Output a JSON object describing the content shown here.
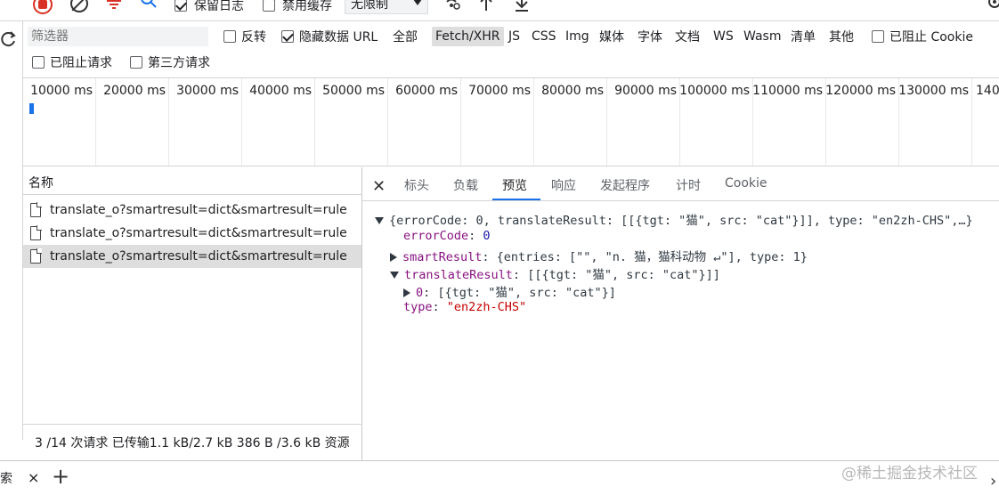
{
  "toolbar": {
    "preserve_log": "保留日志",
    "disable_cache": "禁用缓存",
    "throttle": "无限制"
  },
  "filters": {
    "placeholder": "筛选器",
    "invert": "反转",
    "hide_data_urls": "隐藏数据 URL",
    "types": [
      "全部",
      "Fetch/XHR",
      "JS",
      "CSS",
      "Img",
      "媒体",
      "字体",
      "文档",
      "WS",
      "Wasm",
      "清单",
      "其他"
    ],
    "blocked_cookies": "已阻止 Cookie",
    "blocked_requests": "已阻止请求",
    "third_party": "第三方请求"
  },
  "timeline": {
    "ticks": [
      "10000 ms",
      "20000 ms",
      "30000 ms",
      "40000 ms",
      "50000 ms",
      "60000 ms",
      "70000 ms",
      "80000 ms",
      "90000 ms",
      "100000 ms",
      "110000 ms",
      "120000 ms",
      "130000 ms",
      "140"
    ]
  },
  "requests": {
    "header": "名称",
    "items": [
      "translate_o?smartresult=dict&smartresult=rule",
      "translate_o?smartresult=dict&smartresult=rule",
      "translate_o?smartresult=dict&smartresult=rule"
    ],
    "footer": "3 /14 次请求  已传输1.1 kB/2.7 kB  386 B /3.6 kB 资源"
  },
  "detail": {
    "tabs": [
      "标头",
      "负载",
      "预览",
      "响应",
      "发起程序",
      "计时",
      "Cookie"
    ],
    "active_tab": "预览",
    "json": {
      "summary": "{errorCode: 0, translateResult: [[{tgt: \"猫\", src: \"cat\"}]], type: \"en2zh-CHS\",…}",
      "errorCode_key": "errorCode",
      "errorCode_val": "0",
      "smartResult_key": "smartResult",
      "smartResult_val": "{entries: [\"\", \"n. 猫，猫科动物 ↵\"], type: 1}",
      "translateResult_key": "translateResult",
      "translateResult_val": "[[{tgt: \"猫\", src: \"cat\"}]]",
      "item0_key": "0",
      "item0_val": "[{tgt: \"猫\", src: \"cat\"}]",
      "type_key": "type",
      "type_val": "\"en2zh-CHS\""
    }
  },
  "drawer": {
    "tab_label": "搜索",
    "close": "×",
    "add": "+"
  },
  "watermark": "@稀土掘金技术社区"
}
